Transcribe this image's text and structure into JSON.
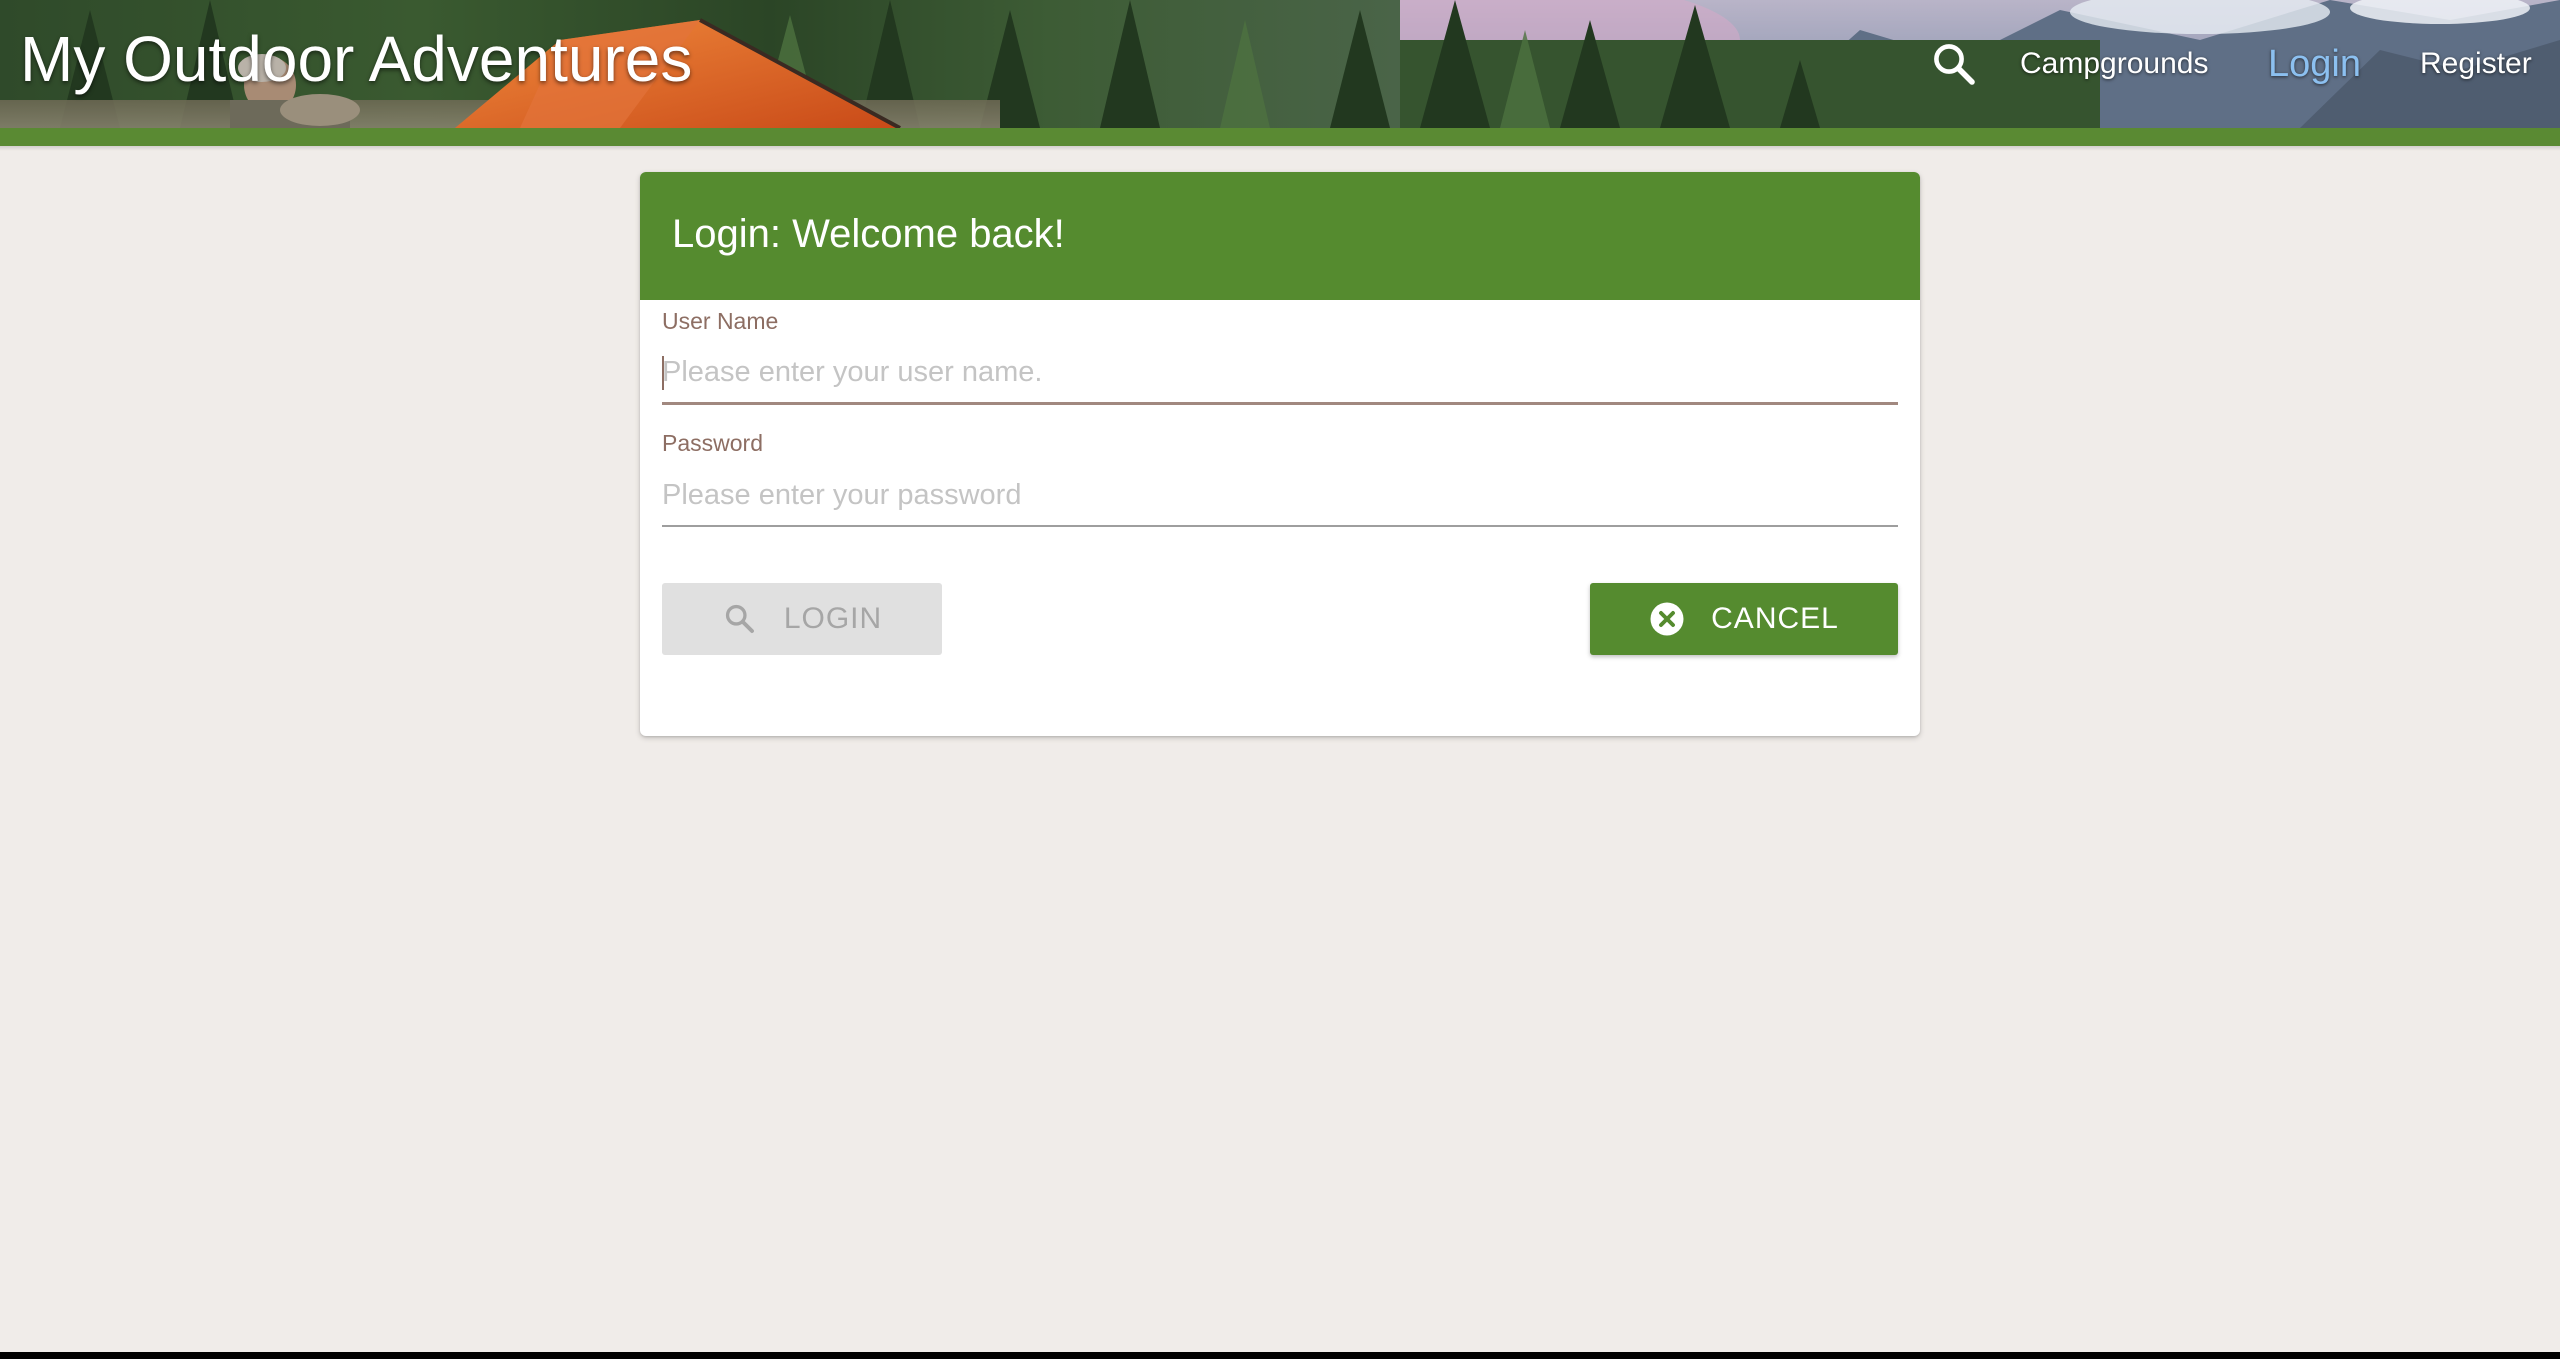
{
  "site": {
    "title": "My Outdoor Adventures"
  },
  "nav": {
    "search_icon": "search-icon",
    "items": [
      {
        "label": "Campgrounds",
        "active": false
      },
      {
        "label": "Login",
        "active": true
      },
      {
        "label": "Register",
        "active": false
      }
    ]
  },
  "login_card": {
    "title": "Login: Welcome back!",
    "username": {
      "label": "User Name",
      "value": "",
      "placeholder": "Please enter your user name."
    },
    "password": {
      "label": "Password",
      "value": "",
      "placeholder": "Please enter your password"
    },
    "login_button": {
      "label": "LOGIN",
      "icon": "search-icon",
      "disabled": true
    },
    "cancel_button": {
      "label": "CANCEL",
      "icon": "cancel-circle-icon"
    }
  },
  "colors": {
    "primary_green": "#558b2f",
    "banner_bar": "#5a8a33",
    "page_background": "#f0ece9",
    "label_brown": "#8d6e63",
    "active_nav_link": "#8cc0f0",
    "disabled_button": "#e0e0e0"
  }
}
